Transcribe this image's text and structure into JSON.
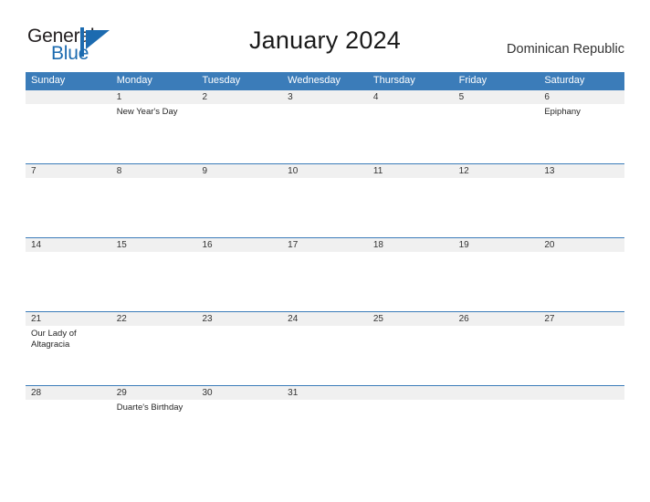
{
  "brand": {
    "name_part1": "General",
    "name_part2": "Blue",
    "logo_icon": "triangle-flag-icon"
  },
  "header": {
    "title": "January 2024",
    "region": "Dominican Republic"
  },
  "calendar": {
    "weekdays": [
      "Sunday",
      "Monday",
      "Tuesday",
      "Wednesday",
      "Thursday",
      "Friday",
      "Saturday"
    ],
    "accent_color": "#3b7cb9",
    "band_color": "#f0f0f0",
    "weeks": [
      {
        "dates": [
          "",
          "1",
          "2",
          "3",
          "4",
          "5",
          "6"
        ],
        "events": [
          "",
          "New Year's Day",
          "",
          "",
          "",
          "",
          "Epiphany"
        ]
      },
      {
        "dates": [
          "7",
          "8",
          "9",
          "10",
          "11",
          "12",
          "13"
        ],
        "events": [
          "",
          "",
          "",
          "",
          "",
          "",
          ""
        ]
      },
      {
        "dates": [
          "14",
          "15",
          "16",
          "17",
          "18",
          "19",
          "20"
        ],
        "events": [
          "",
          "",
          "",
          "",
          "",
          "",
          ""
        ]
      },
      {
        "dates": [
          "21",
          "22",
          "23",
          "24",
          "25",
          "26",
          "27"
        ],
        "events": [
          "Our Lady of Altagracia",
          "",
          "",
          "",
          "",
          "",
          ""
        ]
      },
      {
        "dates": [
          "28",
          "29",
          "30",
          "31",
          "",
          "",
          ""
        ],
        "events": [
          "",
          "Duarte's Birthday",
          "",
          "",
          "",
          "",
          ""
        ]
      }
    ]
  }
}
